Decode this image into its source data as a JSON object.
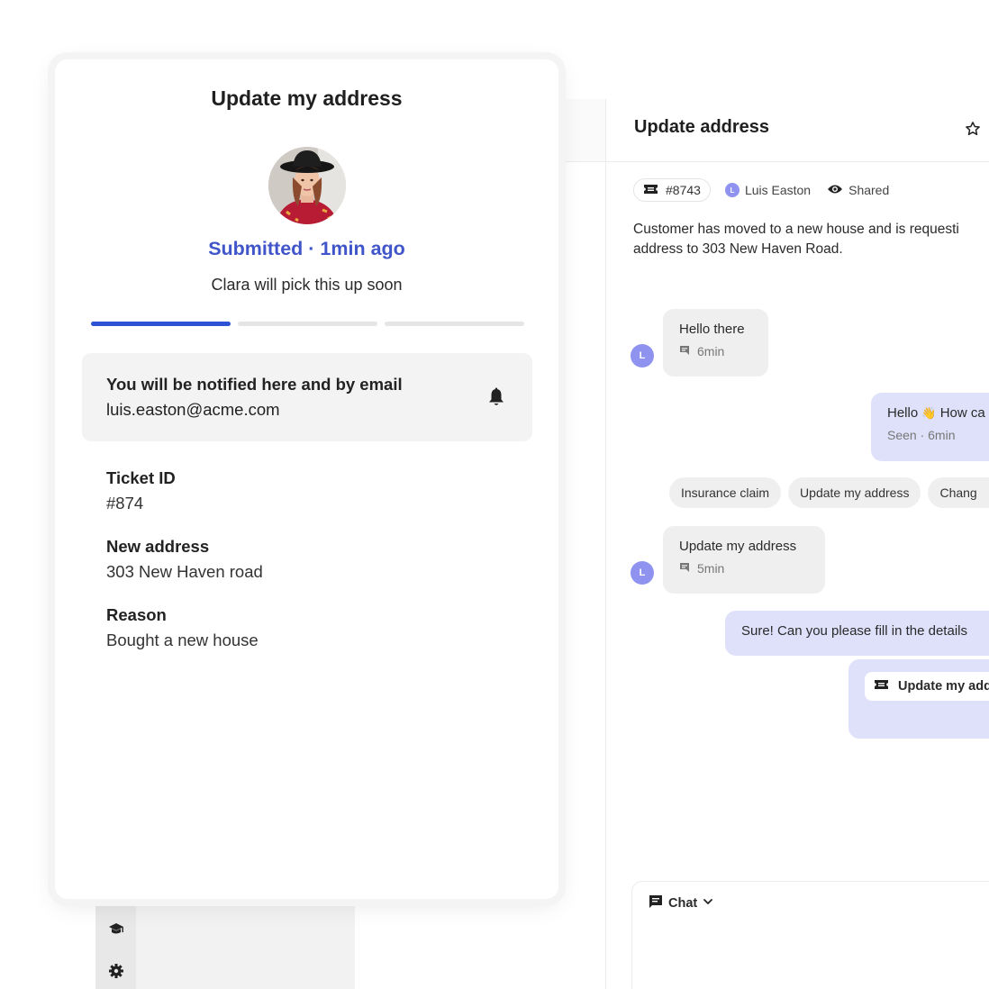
{
  "ticket_card": {
    "title": "Update my address",
    "status": "Submitted · 1min ago",
    "subtitle": "Clara will pick this up soon",
    "progress": {
      "steps": 3,
      "completed": 1
    },
    "notification": {
      "title": "You will be notified here and by email",
      "email": "luis.easton@acme.com"
    },
    "fields": [
      {
        "label": "Ticket ID",
        "value": "#874"
      },
      {
        "label": "New address",
        "value": "303 New Haven road"
      },
      {
        "label": "Reason",
        "value": "Bought a new house"
      }
    ]
  },
  "conversation": {
    "title": "Update address",
    "ticket_ref": "#8743",
    "assignee_initial": "L",
    "assignee_name": "Luis Easton",
    "visibility": "Shared",
    "description_line1": "Customer has moved to a new house and is requesti",
    "description_line2": "address to 303 New Haven Road.",
    "messages": [
      {
        "initial": "L",
        "text": "Hello there",
        "time": "6min"
      },
      {
        "text": "Hello",
        "text_rest": "How ca",
        "emoji": "👋",
        "meta": "Seen · 6min"
      },
      {
        "initial": "L",
        "text": "Update my address",
        "time": "5min"
      },
      {
        "text": "Sure! Can you please fill in the details"
      }
    ],
    "suggestions": [
      "Insurance claim",
      "Update my address",
      "Chang"
    ],
    "form_button_label": "Update my add",
    "composer_mode": "Chat"
  },
  "colors": {
    "accent_blue": "#3f55c9",
    "progress_blue": "#2d52d6",
    "avatar_purple": "#8f93ef",
    "outgoing_bubble": "#dfe1fb",
    "incoming_bubble": "#efefef"
  },
  "icons": [
    "graduation-cap-icon",
    "gear-icon",
    "star-icon",
    "ticket-icon",
    "eye-icon",
    "message-icon",
    "bell-icon",
    "chat-icon",
    "chevron-down-icon"
  ]
}
